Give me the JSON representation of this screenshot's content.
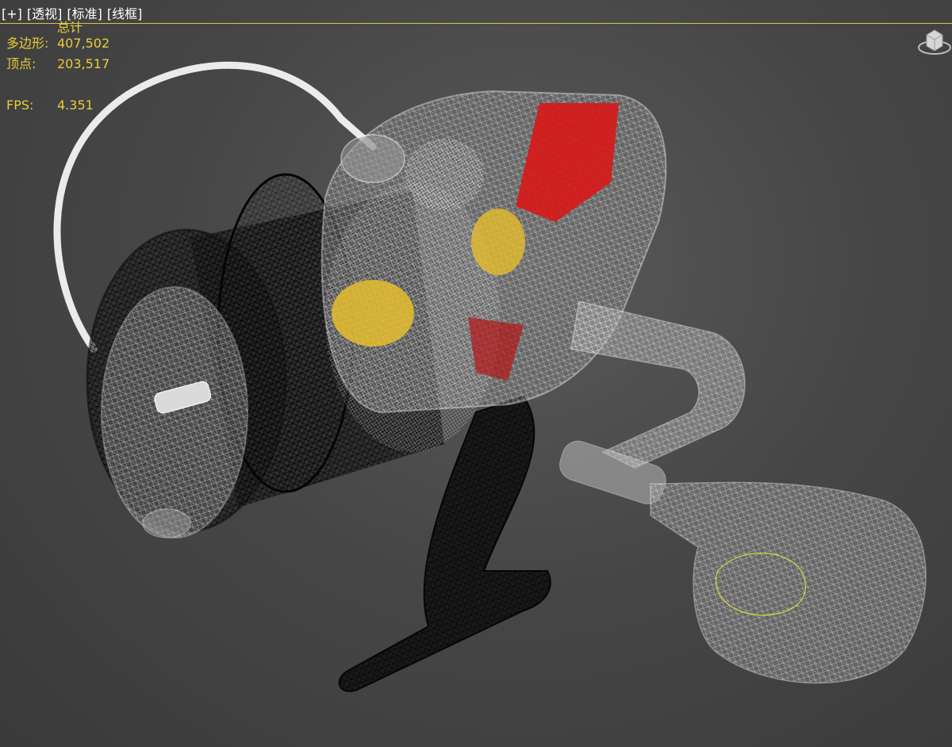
{
  "viewport": {
    "labels": [
      "[+]",
      "[透视]",
      "[标准]",
      "[线框]"
    ]
  },
  "stats": {
    "total_label": "总计",
    "poly_label": "多边形:",
    "poly_value": "407,502",
    "vert_label": "顶点:",
    "vert_value": "203,517",
    "fps_label": "FPS:",
    "fps_value": "4.351"
  },
  "colors": {
    "background": "#474747",
    "stats_text": "#e8cc3a",
    "wire_white": "#f0f0f0",
    "wire_black": "#0a0a0a",
    "accent_red": "#e01818",
    "accent_yellow": "#e8c030"
  },
  "icons": {
    "viewcube": "viewcube-icon"
  }
}
